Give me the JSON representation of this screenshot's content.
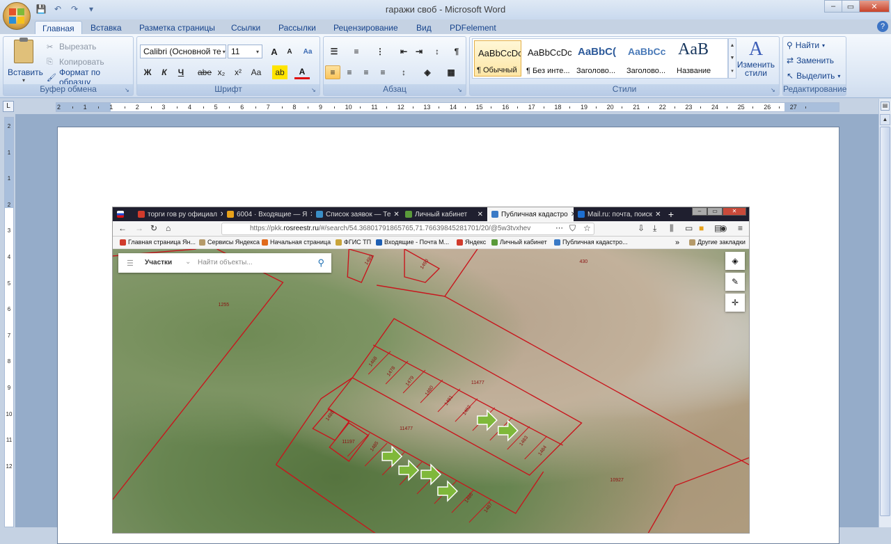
{
  "window": {
    "title": "гаражи своб - Microsoft Word",
    "minimize": "–",
    "maximize": "▭",
    "close": "✕",
    "help": "?"
  },
  "ribbon_tabs": [
    {
      "label": "Главная",
      "active": true
    },
    {
      "label": "Вставка"
    },
    {
      "label": "Разметка страницы"
    },
    {
      "label": "Ссылки"
    },
    {
      "label": "Рассылки"
    },
    {
      "label": "Рецензирование"
    },
    {
      "label": "Вид"
    },
    {
      "label": "PDFelement"
    }
  ],
  "clipboard": {
    "paste": "Вставить",
    "cut": "Вырезать",
    "copy": "Копировать",
    "format_painter": "Формат по образцу",
    "label": "Буфер обмена"
  },
  "font": {
    "name": "Calibri (Основной те",
    "size": "11",
    "label": "Шрифт",
    "grow": "A",
    "shrink": "A",
    "clear": "Aa",
    "bold": "Ж",
    "italic": "К",
    "underline": "Ч",
    "strike": "abe",
    "subscript": "x₂",
    "superscript": "x²",
    "case": "Aa",
    "highlight": "ab",
    "color": "A"
  },
  "paragraph": {
    "label": "Абзац",
    "show_marks": "¶"
  },
  "styles": {
    "label": "Стили",
    "items": [
      {
        "sample": "AaBbCcDc",
        "name": "¶ Обычный",
        "selected": true
      },
      {
        "sample": "AaBbCcDc",
        "name": "¶ Без инте..."
      },
      {
        "sample": "AaBbC(",
        "name": "Заголово..."
      },
      {
        "sample": "AaBbCc",
        "name": "Заголово..."
      },
      {
        "sample": "AaB",
        "name": "Название"
      }
    ],
    "change_styles": "Изменить стили"
  },
  "editing": {
    "label": "Редактирование",
    "find": "Найти",
    "replace": "Заменить",
    "select": "Выделить"
  },
  "ruler": {
    "corner": "L",
    "numbers": [
      "2",
      "1",
      "1",
      "2",
      "3",
      "4",
      "5",
      "6",
      "7",
      "8",
      "9",
      "10",
      "11",
      "12",
      "13",
      "14",
      "15",
      "16",
      "17",
      "18",
      "19",
      "20",
      "21",
      "22",
      "23",
      "24",
      "25",
      "26",
      "27"
    ],
    "vnumbers": [
      "2",
      "1",
      "1",
      "2",
      "3",
      "4",
      "5",
      "6",
      "7",
      "8",
      "9",
      "10",
      "11",
      "12"
    ]
  },
  "browser": {
    "tabs": [
      {
        "label": "торги гов ру официал",
        "color": "#d13b2c"
      },
      {
        "label": "6004 · Входящие — Я",
        "color": "#e8a21a"
      },
      {
        "label": "Список заявок — Те",
        "color": "#3a8ec6"
      },
      {
        "label": "Личный кабинет",
        "color": "#5a9a3a"
      },
      {
        "label": "Публичная кадастро",
        "color": "#3a7ac6",
        "active": true
      },
      {
        "label": "Mail.ru: почта, поиск",
        "color": "#1e6fd1"
      }
    ],
    "new_tab": "+",
    "url_prefix": "https://pkk.",
    "url_host": "rosreestr.ru",
    "url_rest": "/#/search/54.36801791865765,71.76639845281701/20/@5w3tvxhev",
    "bookmarks": [
      {
        "label": "Главная страница Ян...",
        "color": "#d13b2c"
      },
      {
        "label": "Сервисы Яндекса",
        "color": "#b59a6a"
      },
      {
        "label": "Начальная страница",
        "color": "#e06a1a"
      },
      {
        "label": "ФГИС ТП",
        "color": "#c9a43a"
      },
      {
        "label": "Входящие - Почта М...",
        "color": "#1e5fb3"
      },
      {
        "label": "Яндекс",
        "color": "#d13b2c"
      },
      {
        "label": "Личный кабинет",
        "color": "#5a9a3a"
      },
      {
        "label": "Публичная кадастро...",
        "color": "#3a7ac6"
      }
    ],
    "other_bookmarks": "Другие закладки"
  },
  "map": {
    "search_category": "Участки",
    "search_placeholder": "Найти объекты...",
    "parcel_labels": [
      "1255",
      "430",
      "11477",
      "11477",
      "11197",
      "10927"
    ],
    "lot_numbers": [
      "1468",
      "1478",
      "1479",
      "1480",
      "1481",
      "1482",
      "1483",
      "1484",
      "1485",
      "1486",
      "1487",
      "1488",
      "1489",
      "1490",
      "1491"
    ]
  }
}
